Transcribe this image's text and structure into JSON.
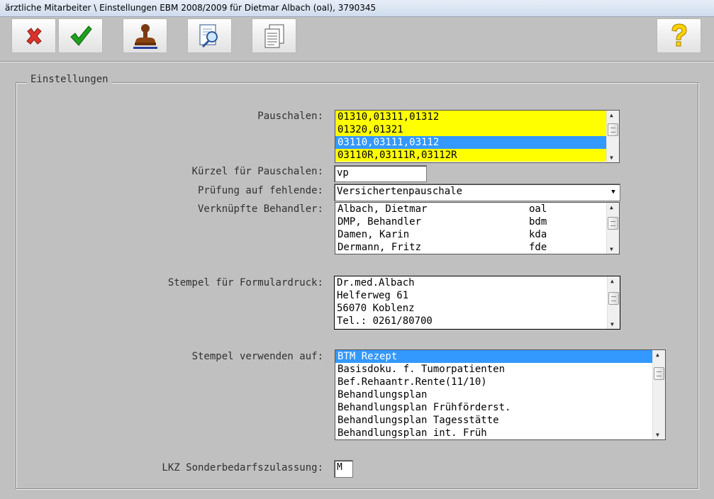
{
  "window": {
    "title": "ärztliche Mitarbeiter \\ Einstellungen EBM 2008/2009 für Dietmar Albach (oal), 3790345"
  },
  "toolbar": {
    "buttons": [
      {
        "icon": "cancel-x-icon"
      },
      {
        "icon": "checkmark-icon"
      },
      {
        "icon": "stamp-icon"
      },
      {
        "icon": "document-search-icon"
      },
      {
        "icon": "documents-icon"
      },
      {
        "icon": "help-question-icon"
      }
    ]
  },
  "group": {
    "title": "Einstellungen"
  },
  "labels": {
    "pauschalen": "Pauschalen:",
    "kuerzel": "Kürzel für Pauschalen:",
    "pruefung": "Prüfung auf fehlende:",
    "behandler": "Verknüpfte Behandler:",
    "stempel": "Stempel für Formulardruck:",
    "stempel_verwenden": "Stempel verwenden auf:",
    "lkz": "LKZ Sonderbedarfszulassung:"
  },
  "pauschalen_list": [
    {
      "text": "01310,01311,01312",
      "state": "yellow"
    },
    {
      "text": "01320,01321",
      "state": "yellow"
    },
    {
      "text": "03110,03111,03112",
      "state": "selected"
    },
    {
      "text": "03110R,03111R,03112R",
      "state": "yellow"
    }
  ],
  "kuerzel_value": "vp",
  "pruefung_value": "Versichertenpauschale",
  "behandler_list": [
    {
      "name": "Albach, Dietmar",
      "code": "oal"
    },
    {
      "name": "DMP, Behandler",
      "code": "bdm"
    },
    {
      "name": "Damen, Karin",
      "code": "kda"
    },
    {
      "name": "Dermann, Fritz",
      "code": "fde"
    }
  ],
  "stempel_lines": [
    "Dr.med.Albach",
    "Helferweg 61",
    "56070 Koblenz",
    "Tel.: 0261/80700"
  ],
  "stempel_verwenden_list": [
    {
      "text": "BTM Rezept",
      "selected": true
    },
    {
      "text": "Basisdoku. f. Tumorpatienten",
      "selected": false
    },
    {
      "text": "Bef.Rehaantr.Rente(11/10)",
      "selected": false
    },
    {
      "text": "Behandlungsplan",
      "selected": false
    },
    {
      "text": "Behandlungsplan Frühförderst.",
      "selected": false
    },
    {
      "text": "Behandlungsplan Tagesstätte",
      "selected": false
    },
    {
      "text": "Behandlungsplan int. Früh",
      "selected": false
    }
  ],
  "lkz_value": "M",
  "colors": {
    "highlight": "#3399ff",
    "yellow": "#ffff00",
    "background": "#c0c0c0"
  }
}
